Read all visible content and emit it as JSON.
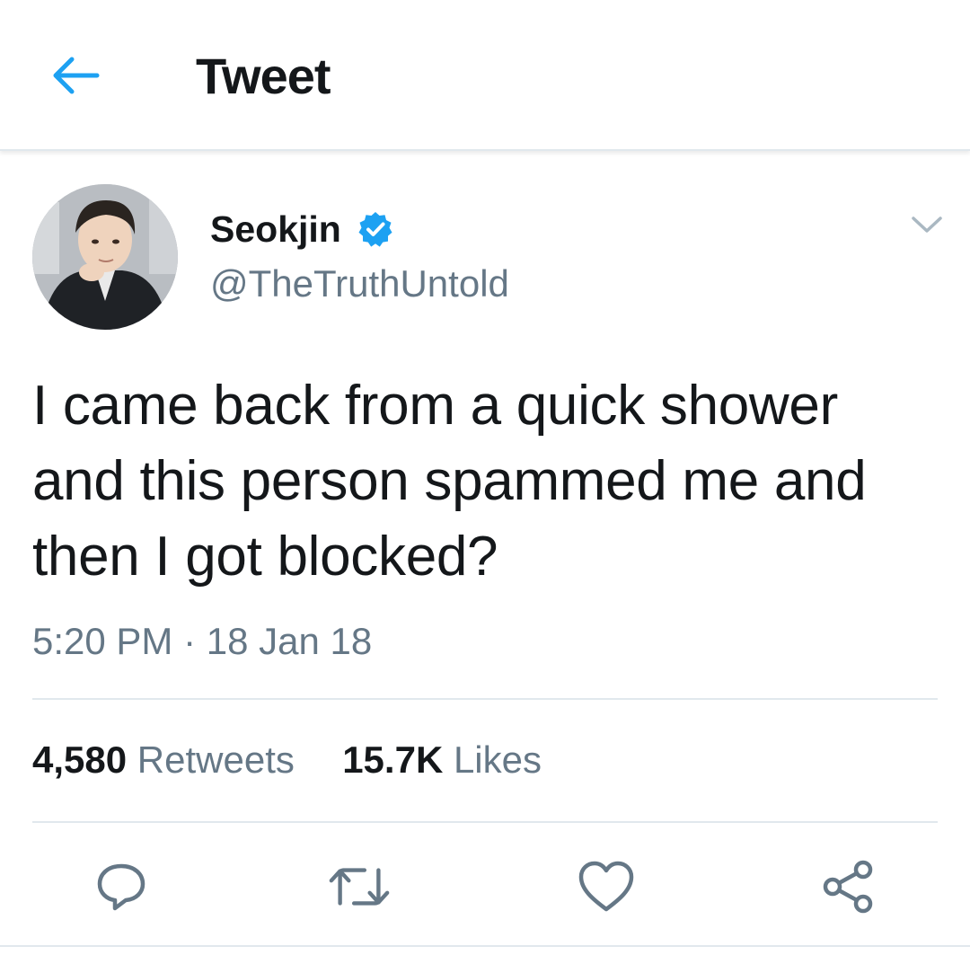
{
  "header": {
    "title": "Tweet",
    "back_icon": "arrow-left-icon",
    "accent_color": "#1da1f2"
  },
  "author": {
    "display_name": "Seokjin",
    "handle": "@TheTruthUntold",
    "verified": true,
    "verified_color": "#1da1f2"
  },
  "tweet": {
    "text": "I came back from a quick shower and this person spammed me and then I got blocked?",
    "timestamp": "5:20 PM · 18 Jan 18"
  },
  "stats": {
    "retweets_count": "4,580",
    "retweets_label": "Retweets",
    "likes_count": "15.7K",
    "likes_label": "Likes"
  },
  "actions": {
    "icons": [
      "reply-icon",
      "retweet-icon",
      "like-icon",
      "share-icon"
    ],
    "icon_color": "#657786"
  }
}
